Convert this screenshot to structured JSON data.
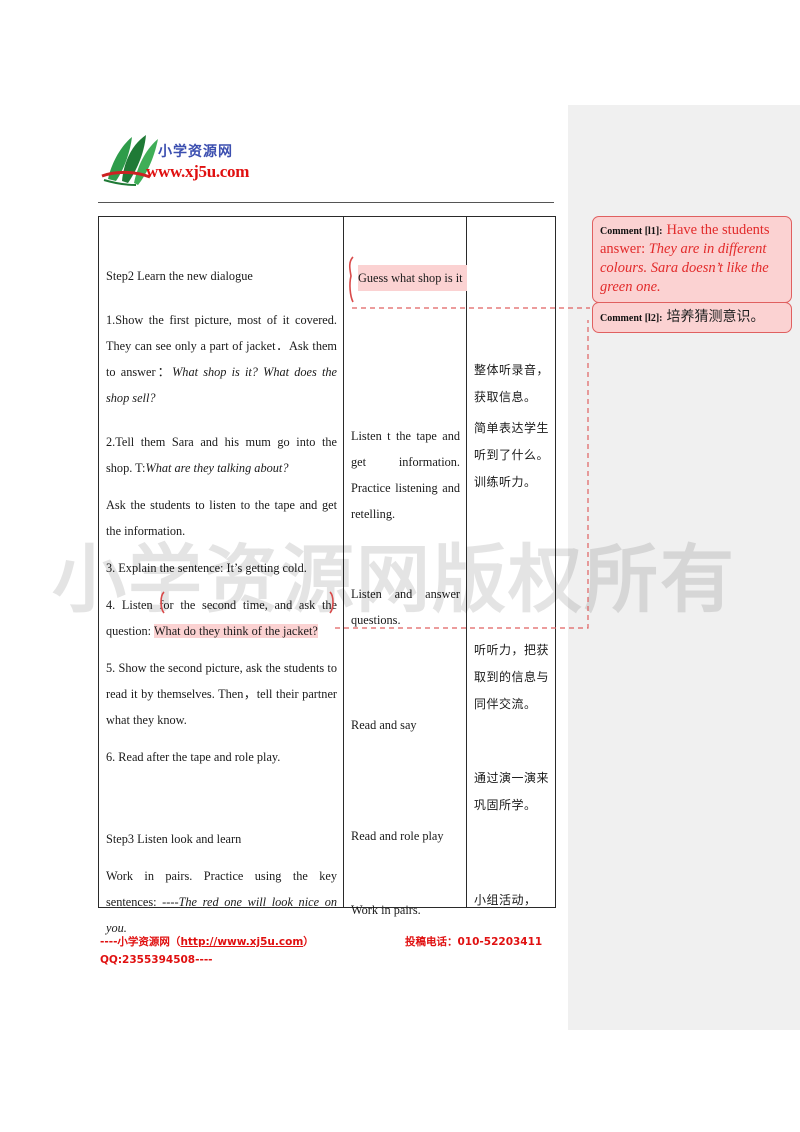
{
  "logo": {
    "cn_name": "小学资源网",
    "url": "www.xj5u.com"
  },
  "watermark": "小学资源网版权所有",
  "table": {
    "column_a": {
      "p1": "Step2 Learn the new dialogue",
      "p2_pre": "1.Show the first picture, most of it covered. They can see only a part of jacket．Ask them to answer：",
      "p2_italic": "What shop is it? What does the shop sell?",
      "p3_pre": "2.Tell them Sara and his mum go into the shop. T:",
      "p3_italic": "What are they talking about?",
      "p4": "Ask the students to listen to the tape and get the information.",
      "p5": "3. Explain the sentence: It’s getting cold.",
      "p6_pre": "4. Listen for the second time, and ask the question: ",
      "p6_hl": "What do they think of the jacket?",
      "p7": "5. Show the second picture, ask the students to read it by themselves. Then，tell their partner what they know.",
      "p8": "6. Read after the tape and role play.",
      "p9": "Step3 Listen look and learn",
      "p10_pre": "Work in pairs. Practice using the key sentences: ----",
      "p10_italic": "The red one will look nice on you."
    },
    "column_b": {
      "b1": "Guess what shop is it",
      "b2": "Listen t the tape and get information. Practice listening and retelling.",
      "b3": "Listen and answer questions.",
      "b4": "Read and say",
      "b5": "Read and role play",
      "b6": "Work in pairs."
    },
    "column_c": {
      "c1": "整体听录音，获取信息。",
      "c2": "简单表达学生听到了什么。训练听力。",
      "c3": "听听力，把获取到的信息与同伴交流。",
      "c4": "通过演一演来巩固所学。",
      "c5": "小组活动，"
    }
  },
  "comments": [
    {
      "label": "Comment [l1]:",
      "text_lead": "Have the students answer: ",
      "text_italic": "They are in different colours. Sara doesn’t like the green one."
    },
    {
      "label": "Comment [l2]:",
      "text_cn": "培养猜测意识。"
    }
  ],
  "footer": {
    "left_prefix": "----小学资源网（",
    "link": "http://www.xj5u.com",
    "left_suffix": "）",
    "right": "投稿电话：010-52203411",
    "qq": "QQ:2355394508----"
  },
  "colors": {
    "brand_red": "#e01010",
    "comment_red": "#e22b2b",
    "highlight": "#fbd2d2",
    "gutter_gray": "#f0f0f0"
  }
}
